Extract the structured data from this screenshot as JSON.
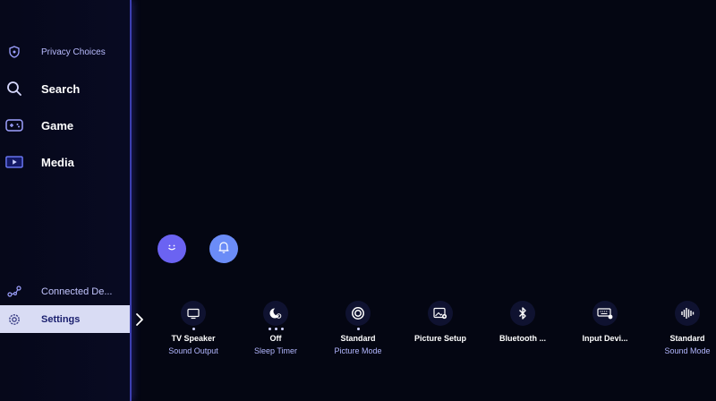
{
  "sidebar": {
    "items": [
      {
        "label": "Privacy Choices",
        "icon": "shield-icon"
      },
      {
        "label": "Search",
        "icon": "search-icon"
      },
      {
        "label": "Game",
        "icon": "gamepad-icon"
      },
      {
        "label": "Media",
        "icon": "media-play-icon"
      },
      {
        "label": "Connected De...",
        "icon": "connected-devices-icon"
      },
      {
        "label": "Settings",
        "icon": "gear-icon"
      }
    ]
  },
  "top_buttons": [
    {
      "icon": "smiley-icon",
      "color": "#6b63f2"
    },
    {
      "icon": "bell-icon",
      "color": "#6b8cf7"
    }
  ],
  "quick_settings": [
    {
      "title": "TV Speaker",
      "subtitle": "Sound Output",
      "icon": "tv-icon"
    },
    {
      "title": "Off",
      "subtitle": "Sleep Timer",
      "icon": "sleep-timer-icon"
    },
    {
      "title": "Standard",
      "subtitle": "Picture Mode",
      "icon": "picture-mode-icon"
    },
    {
      "title": "Picture Setup",
      "subtitle": "",
      "icon": "picture-setup-icon"
    },
    {
      "title": "Bluetooth ...",
      "subtitle": "",
      "icon": "bluetooth-icon"
    },
    {
      "title": "Input Devi...",
      "subtitle": "",
      "icon": "input-device-icon"
    },
    {
      "title": "Standard",
      "subtitle": "Sound Mode",
      "icon": "sound-mode-icon"
    }
  ],
  "colors": {
    "background": "#040612",
    "accent": "#3c3fb0",
    "active_item_bg": "#d9dcf4"
  }
}
